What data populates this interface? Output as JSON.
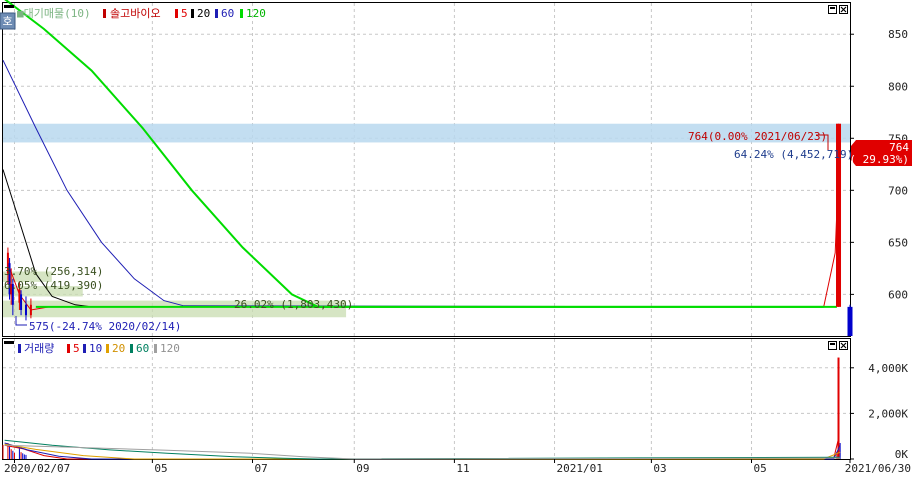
{
  "price_legend": {
    "badge": "호",
    "supply_label": "■대기매물(10)",
    "stock_name": "솔고바이오",
    "ma5": "5",
    "ma20": "20",
    "ma60": "60",
    "ma120": "120"
  },
  "volume_legend": {
    "label": "거래량",
    "ma5": "5",
    "ma10": "10",
    "ma20": "20",
    "ma60": "60",
    "ma120": "120"
  },
  "annotations": {
    "high": "764(0.00% 2021/06/23)",
    "low": "575(-24.74% 2020/02/14)",
    "band_top": "64.24% (4,452,719)",
    "band_bottom": "26.02% (1,803,430)",
    "band_small_1": "3.70% (256,314)",
    "band_small_2": "6.05% (419,390)",
    "current_price": "764",
    "current_change": "( 29.93%)"
  },
  "colors": {
    "up": "#e00000",
    "down": "#0000cc",
    "ma5": "#e00000",
    "ma20": "#000000",
    "ma60": "#1e1eb4",
    "ma120": "#00dc00",
    "vol_ma20": "#e0a000",
    "vol_ma60": "#008060",
    "vol_ma120": "#a0a0a0",
    "band": "#b8d8ee",
    "band_low": "#c8dcb0"
  },
  "chart_data": [
    {
      "type": "line",
      "title": "솔고바이오",
      "x_range": [
        "2020/01/31",
        "2021/06/30"
      ],
      "ylim": [
        560,
        880
      ],
      "y_ticks": [
        600,
        650,
        700,
        750,
        800,
        850
      ],
      "x_tick_labels": [
        {
          "date": "2020/02/07",
          "label": "2020/02/07"
        },
        {
          "date": "2020/05/01",
          "label": "05"
        },
        {
          "date": "2020/07/01",
          "label": "07"
        },
        {
          "date": "2020/09/01",
          "label": "09"
        },
        {
          "date": "2020/11/01",
          "label": "11"
        },
        {
          "date": "2021/01/01",
          "label": "2021/01"
        },
        {
          "date": "2021/03/01",
          "label": "03"
        },
        {
          "date": "2021/05/01",
          "label": "05"
        },
        {
          "date": "2021/06/30",
          "label": "2021/06/30"
        }
      ],
      "grid": true,
      "series": [
        {
          "name": "5",
          "points": [
            [
              "2020/02/03",
              630
            ],
            [
              "2020/02/10",
              600
            ],
            [
              "2020/02/17",
              585
            ],
            [
              "2020/02/28",
              588
            ],
            [
              "2021/06/14",
              588
            ],
            [
              "2021/06/21",
              640
            ],
            [
              "2021/06/23",
              720
            ]
          ]
        },
        {
          "name": "20",
          "points": [
            [
              "2020/01/31",
              720
            ],
            [
              "2020/02/10",
              670
            ],
            [
              "2020/02/20",
              620
            ],
            [
              "2020/03/01",
              598
            ],
            [
              "2020/03/15",
              590
            ],
            [
              "2020/03/25",
              588
            ],
            [
              "2021/06/14",
              588
            ]
          ]
        },
        {
          "name": "60",
          "points": [
            [
              "2020/01/31",
              825
            ],
            [
              "2020/02/20",
              760
            ],
            [
              "2020/03/10",
              700
            ],
            [
              "2020/03/31",
              650
            ],
            [
              "2020/04/20",
              615
            ],
            [
              "2020/05/08",
              594
            ],
            [
              "2020/05/20",
              589
            ],
            [
              "2021/06/14",
              588
            ]
          ]
        },
        {
          "name": "120",
          "points": [
            [
              "2020/01/31",
              885
            ],
            [
              "2020/02/25",
              855
            ],
            [
              "2020/03/25",
              815
            ],
            [
              "2020/04/25",
              760
            ],
            [
              "2020/05/25",
              700
            ],
            [
              "2020/06/25",
              645
            ],
            [
              "2020/07/25",
              600
            ],
            [
              "2020/08/10",
              588
            ],
            [
              "2021/06/14",
              588
            ]
          ]
        }
      ],
      "candles": [
        {
          "date": "2020/02/03",
          "open": 620,
          "close": 640,
          "high": 645,
          "low": 610,
          "dir": "up"
        },
        {
          "date": "2020/02/04",
          "open": 630,
          "close": 600,
          "high": 635,
          "low": 595,
          "dir": "down"
        },
        {
          "date": "2020/02/05",
          "open": 600,
          "close": 610,
          "high": 625,
          "low": 590,
          "dir": "up"
        },
        {
          "date": "2020/02/06",
          "open": 610,
          "close": 590,
          "high": 615,
          "low": 580,
          "dir": "down"
        },
        {
          "date": "2020/02/10",
          "open": 592,
          "close": 605,
          "high": 612,
          "low": 585,
          "dir": "up"
        },
        {
          "date": "2020/02/11",
          "open": 600,
          "close": 585,
          "high": 604,
          "low": 580,
          "dir": "down"
        },
        {
          "date": "2020/02/14",
          "open": 590,
          "close": 580,
          "high": 598,
          "low": 575,
          "dir": "down"
        },
        {
          "date": "2020/02/17",
          "open": 580,
          "close": 590,
          "high": 596,
          "low": 577,
          "dir": "up"
        },
        {
          "date": "2021/06/23",
          "open": 588,
          "close": 764,
          "high": 764,
          "low": 588,
          "dir": "up"
        },
        {
          "date": "2021/06/30",
          "open": 588,
          "close": 560,
          "high": 590,
          "low": 560,
          "dir": "down"
        }
      ],
      "flat_price_period": {
        "from": "2020/02/20",
        "to": "2021/06/22",
        "value": 588
      },
      "supply_bands": [
        {
          "price_low": 746,
          "price_high": 764,
          "pct": 64.24,
          "volume": 4452719
        },
        {
          "price_low": 578,
          "price_high": 594,
          "pct": 26.02,
          "volume": 1803430
        },
        {
          "price_low": 612,
          "price_high": 622,
          "pct": 3.7,
          "volume": 256314
        },
        {
          "price_low": 598,
          "price_high": 608,
          "pct": 6.05,
          "volume": 419390
        }
      ]
    },
    {
      "type": "bar",
      "title": "거래량",
      "ylim": [
        0,
        5000
      ],
      "y_unit": "K",
      "y_ticks": [
        {
          "value": 0,
          "label": "0K"
        },
        {
          "value": 2000,
          "label": "2,000K"
        },
        {
          "value": 4000,
          "label": "4,000K"
        }
      ],
      "bars": [
        {
          "date": "2020/01/31",
          "value": 620,
          "dir": "up"
        },
        {
          "date": "2020/02/03",
          "value": 700,
          "dir": "up"
        },
        {
          "date": "2020/02/04",
          "value": 540,
          "dir": "down"
        },
        {
          "date": "2020/02/05",
          "value": 430,
          "dir": "up"
        },
        {
          "date": "2020/02/06",
          "value": 360,
          "dir": "down"
        },
        {
          "date": "2020/02/07",
          "value": 280,
          "dir": "up"
        },
        {
          "date": "2020/02/10",
          "value": 520,
          "dir": "down"
        },
        {
          "date": "2020/02/11",
          "value": 300,
          "dir": "up"
        },
        {
          "date": "2020/02/12",
          "value": 250,
          "dir": "down"
        },
        {
          "date": "2020/02/13",
          "value": 200,
          "dir": "down"
        },
        {
          "date": "2020/02/14",
          "value": 180,
          "dir": "down"
        },
        {
          "date": "2021/06/22",
          "value": 300,
          "dir": "up"
        },
        {
          "date": "2021/06/23",
          "value": 4450,
          "dir": "up"
        },
        {
          "date": "2021/06/24",
          "value": 700,
          "dir": "down"
        }
      ],
      "series": [
        {
          "name": "5",
          "points": [
            [
              "2020/02/01",
              600
            ],
            [
              "2020/02/12",
              450
            ],
            [
              "2020/02/25",
              150
            ],
            [
              "2020/03/10",
              0
            ],
            [
              "2021/06/20",
              0
            ],
            [
              "2021/06/23",
              900
            ]
          ]
        },
        {
          "name": "10",
          "points": [
            [
              "2020/02/01",
              700
            ],
            [
              "2020/02/15",
              400
            ],
            [
              "2020/03/05",
              120
            ],
            [
              "2020/03/25",
              0
            ],
            [
              "2021/06/20",
              0
            ],
            [
              "2021/06/24",
              600
            ]
          ]
        },
        {
          "name": "20",
          "points": [
            [
              "2020/02/01",
              650
            ],
            [
              "2020/02/20",
              420
            ],
            [
              "2020/03/20",
              150
            ],
            [
              "2020/04/20",
              0
            ],
            [
              "2021/06/14",
              0
            ],
            [
              "2021/06/24",
              300
            ]
          ]
        },
        {
          "name": "60",
          "points": [
            [
              "2020/02/01",
              820
            ],
            [
              "2020/03/01",
              600
            ],
            [
              "2020/04/05",
              400
            ],
            [
              "2020/05/10",
              250
            ],
            [
              "2020/06/20",
              100
            ],
            [
              "2020/07/20",
              30
            ],
            [
              "2020/08/10",
              0
            ],
            [
              "2021/06/24",
              80
            ]
          ]
        },
        {
          "name": "120",
          "points": [
            [
              "2020/02/01",
              600
            ],
            [
              "2020/03/20",
              500
            ],
            [
              "2020/05/10",
              380
            ],
            [
              "2020/06/30",
              250
            ],
            [
              "2020/08/01",
              100
            ],
            [
              "2020/09/01",
              0
            ],
            [
              "2021/06/24",
              40
            ]
          ]
        }
      ]
    }
  ]
}
